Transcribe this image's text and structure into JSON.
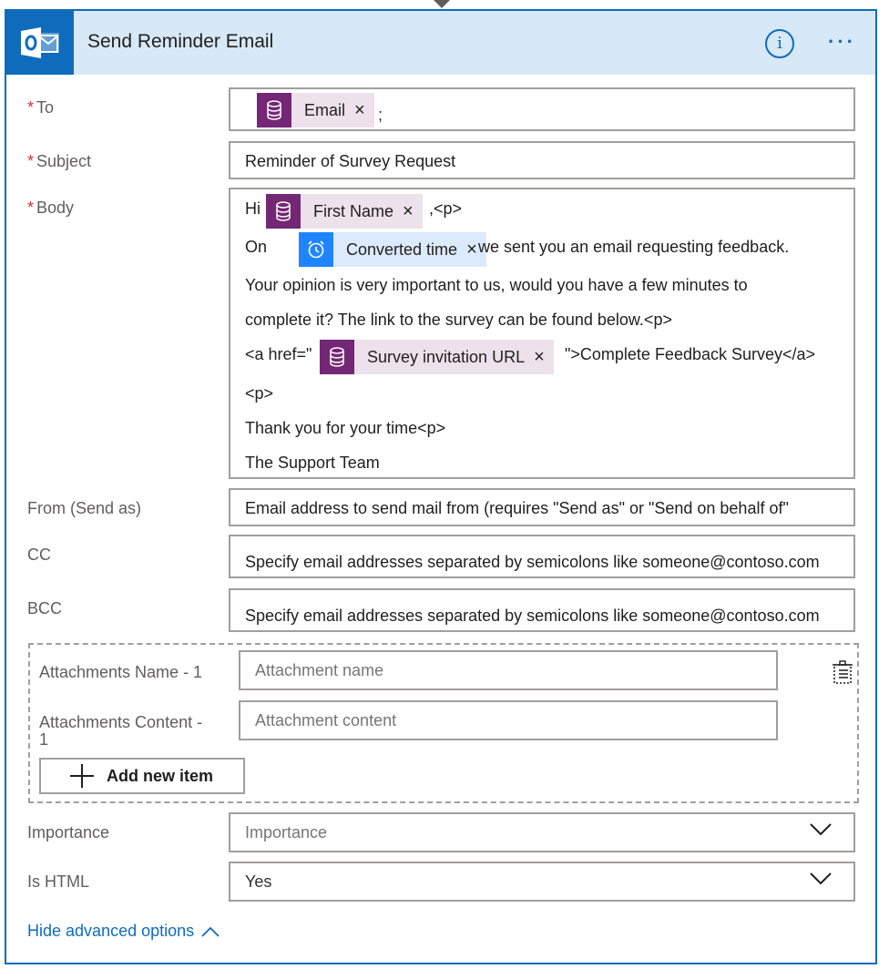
{
  "header": {
    "title": "Send Reminder Email",
    "brand_color": "#0f6cbd",
    "icons": [
      "outlook-icon",
      "info-icon",
      "more-icon"
    ]
  },
  "fields": {
    "to": {
      "label": "To",
      "token": "Email",
      "suffix": ";"
    },
    "subject": {
      "label": "Subject",
      "value": "Reminder of Survey Request"
    },
    "body": {
      "label": "Body",
      "line1_prefix": "Hi",
      "token_first_name": "First Name",
      "line1_suffix": ",<p>",
      "line2_prefix": "On",
      "token_converted_time": "Converted time",
      "line2_suffix": "we sent you an email requesting feedback.",
      "line3": "Your opinion is very important to us, would you have a few minutes to",
      "line4": "complete it? The link to the survey can be found below.<p>",
      "line5_prefix": "<a href=\"",
      "token_survey_url": "Survey invitation URL",
      "line5_suffix": "\">Complete Feedback Survey</a>",
      "line6": "<p>",
      "line7": "Thank you for your time<p>",
      "line8": "The Support Team"
    },
    "from": {
      "label": "From (Send as)",
      "placeholder": "Email address to send mail from (requires \"Send as\" or \"Send on behalf of\""
    },
    "cc": {
      "label": "CC",
      "placeholder": "Specify email addresses separated by semicolons like someone@contoso.com"
    },
    "bcc": {
      "label": "BCC",
      "placeholder": "Specify email addresses separated by semicolons like someone@contoso.com"
    }
  },
  "attachments": {
    "name_label": "Attachments Name - 1",
    "name_placeholder": "Attachment name",
    "content_label_line1": "Attachments Content -",
    "content_label_line2": "1",
    "content_placeholder": "Attachment content",
    "add_button": "Add new item"
  },
  "importance": {
    "label": "Importance",
    "value": "Importance"
  },
  "is_html": {
    "label": "Is HTML",
    "value": "Yes"
  },
  "hide_advanced": "Hide advanced options",
  "required_marker": "*",
  "token_x": "×"
}
